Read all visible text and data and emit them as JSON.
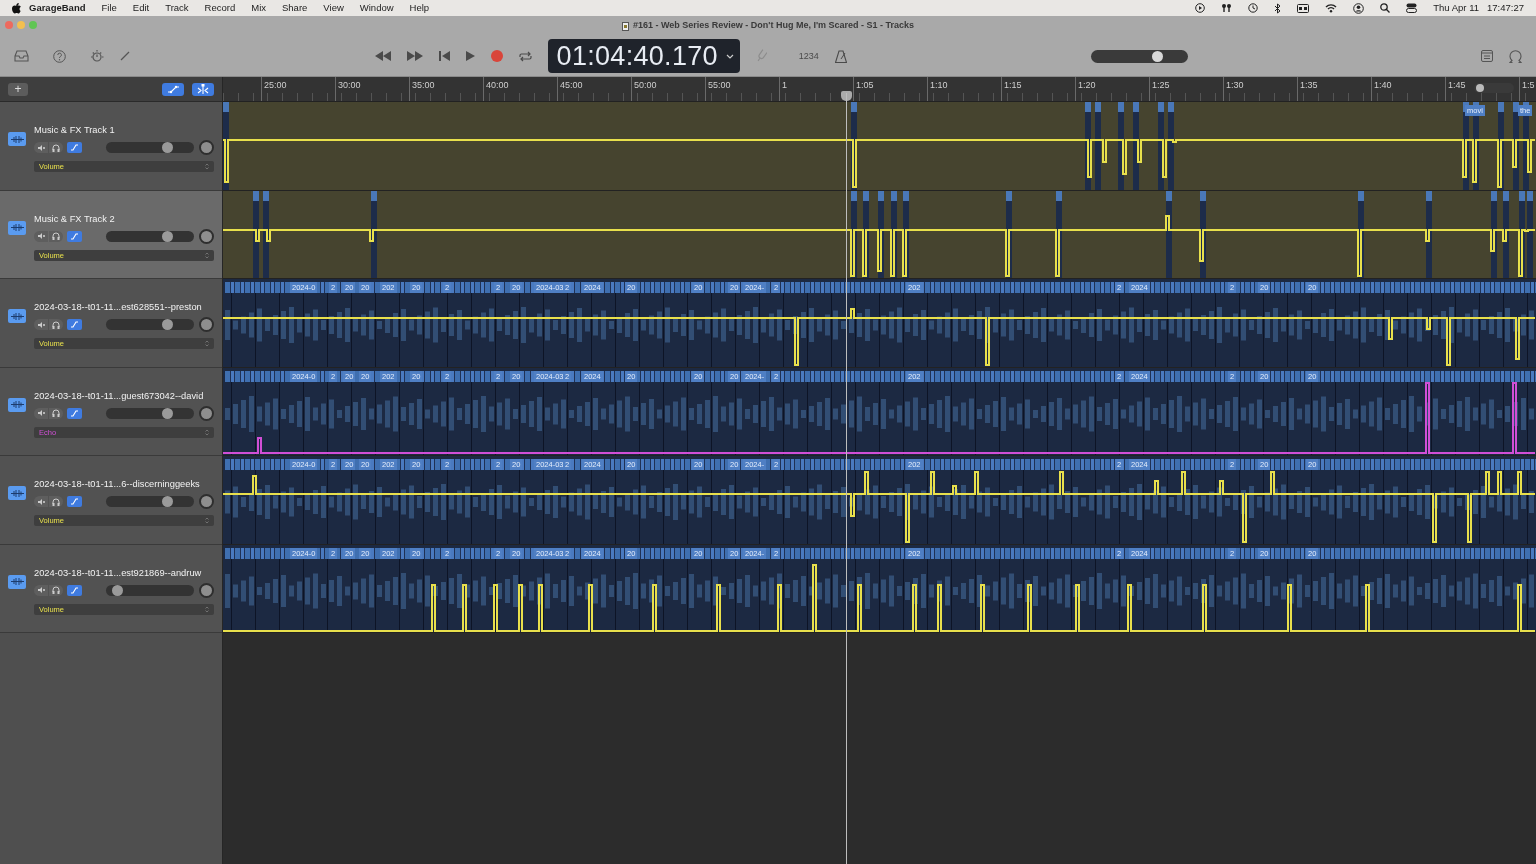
{
  "menu_bar": {
    "app_name": "GarageBand",
    "menus": [
      "File",
      "Edit",
      "Track",
      "Record",
      "Mix",
      "Share",
      "View",
      "Window",
      "Help"
    ],
    "date": "Thu Apr 11",
    "time": "17:47:27"
  },
  "window": {
    "title": "#161 - Web Series Review - Don't Hug Me, I'm Scared - S1 - Tracks"
  },
  "lcd": {
    "time": "01:04:40.170"
  },
  "count_in": {
    "label": "1234"
  },
  "master_volume": {
    "level": 0.68
  },
  "add_button": {
    "label": "+"
  },
  "header_buttons": [
    {
      "kind": "automation",
      "on": true
    },
    {
      "kind": "snap",
      "on": true
    }
  ],
  "ruler": {
    "labels": [
      "25:00",
      "30:00",
      "35:00",
      "40:00",
      "45:00",
      "50:00",
      "55:00",
      "1",
      "1:05",
      "1:10",
      "1:15",
      "1:20",
      "1:25",
      "1:30",
      "1:35",
      "1:40",
      "1:45",
      "1:5"
    ]
  },
  "zoom_slider": {
    "level": 0.05
  },
  "tracks": [
    {
      "name": "Music & FX Track 1",
      "kind": "fx",
      "selected": false,
      "volume": {
        "level": 0.72
      },
      "automation": {
        "parameter": "Volume",
        "color": "#e8e04c"
      },
      "region_labels": [
        "movi",
        "the"
      ]
    },
    {
      "name": "Music & FX Track 2",
      "kind": "fx",
      "selected": true,
      "volume": {
        "level": 0.72
      },
      "automation": {
        "parameter": "Volume",
        "color": "#e8e04c"
      }
    },
    {
      "name": "2024-03-18--t01-11...est628551--preston",
      "kind": "recording",
      "selected": false,
      "volume": {
        "level": 0.72
      },
      "automation": {
        "parameter": "Volume",
        "color": "#e8e04c"
      },
      "region_labels": [
        "2024-0",
        "2",
        "20",
        "20",
        "202",
        "20",
        "2",
        "2",
        "20",
        "2024-03",
        "2",
        "2024",
        "20",
        "20",
        "20",
        "2024-",
        "2",
        "202",
        "2",
        "2024",
        "2",
        "20",
        "20"
      ]
    },
    {
      "name": "2024-03-18--t01-11...guest673042--david",
      "kind": "recording",
      "selected": false,
      "volume": {
        "level": 0.72
      },
      "automation": {
        "parameter": "Echo",
        "color": "#d14fd6"
      },
      "region_labels": [
        "2024-0",
        "2",
        "20",
        "20",
        "202",
        "20",
        "2",
        "2",
        "20",
        "2024-03",
        "2",
        "2024",
        "20",
        "20",
        "20",
        "2024-",
        "2",
        "202",
        "2",
        "2024",
        "2",
        "20",
        "20"
      ]
    },
    {
      "name": "2024-03-18--t01-11...6--discerninggeeks",
      "kind": "recording",
      "selected": false,
      "volume": {
        "level": 0.72
      },
      "automation": {
        "parameter": "Volume",
        "color": "#e8e04c"
      },
      "region_labels": [
        "2024-0",
        "2",
        "20",
        "20",
        "202",
        "20",
        "2",
        "2",
        "20",
        "2024-03",
        "2",
        "2024",
        "20",
        "20",
        "20",
        "2024-",
        "2",
        "202",
        "2",
        "2024",
        "2",
        "20",
        "20"
      ]
    },
    {
      "name": "2024-03-18--t01-11...est921869--andruw",
      "kind": "recording",
      "selected": false,
      "volume": {
        "level": 0.07
      },
      "automation": {
        "parameter": "Volume",
        "color": "#e8e04c"
      },
      "region_labels": [
        "2024-0",
        "2",
        "20",
        "20",
        "202",
        "20",
        "2",
        "2",
        "20",
        "2024-03",
        "2",
        "2024",
        "20",
        "20",
        "20",
        "2024-",
        "2",
        "202",
        "2",
        "2024",
        "2",
        "20",
        "20"
      ]
    }
  ]
}
